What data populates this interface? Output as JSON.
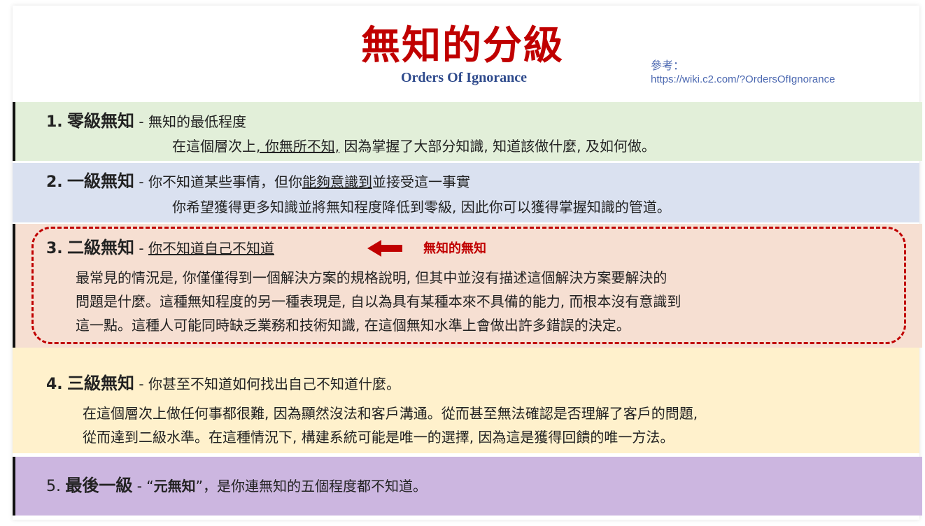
{
  "header": {
    "title": "無知的分級",
    "subtitle": "Orders Of Ignorance",
    "ref_label": "參考：",
    "ref_url": "https://wiki.c2.com/?OrdersOfIgnorance"
  },
  "levels": [
    {
      "number": "1.",
      "name": "零級無知",
      "sep": " - ",
      "headline": "無知的最低程度",
      "detail_pre": "在這個層次上",
      "detail_u": ", 你無所不知,",
      "detail_post": " 因為掌握了大部分知識, 知道該做什麼, 及如何做。"
    },
    {
      "number": "2.",
      "name": "一級無知",
      "sep": " - ",
      "headline_pre": "你不知道某些事情，但你",
      "headline_u": "能夠意識到",
      "headline_post": "並接受這一事實",
      "detail": "你希望獲得更多知識並將無知程度降低到零級, 因此你可以獲得掌握知識的管道。"
    },
    {
      "number": "3.",
      "name": "二級無知",
      "sep": " - ",
      "headline_u": "你不知道自己不知道",
      "callout": "無知的無知",
      "detail_lines": [
        "最常見的情況是, 你僅僅得到一個解決方案的規格說明, 但其中並沒有描述這個解決方案要解決的",
        "問題是什麼。這種無知程度的另一種表現是, 自以為具有某種本來不具備的能力, 而根本沒有意識到",
        "這一點。這種人可能同時缺乏業務和技術知識, 在這個無知水準上會做出許多錯誤的決定。"
      ]
    },
    {
      "number": "4.",
      "name": "三級無知",
      "sep": " - ",
      "headline": "你甚至不知道如何找出自己不知道什麼。",
      "detail_lines": [
        "在這個層次上做任何事都很難, 因為顯然沒法和客戶溝通。從而甚至無法確認是否理解了客戶的問題,",
        "從而達到二級水準。在這種情況下, 構建系統可能是唯一的選擇, 因為這是獲得回饋的唯一方法。"
      ]
    },
    {
      "number": "5.",
      "name": "最後一級",
      "sep": " - ",
      "quote_open": "“",
      "quote_term": "元無知",
      "quote_close": "”，",
      "headline": "是你連無知的五個程度都不知道。"
    }
  ],
  "colors": {
    "title": "#c00000",
    "subtitle": "#2e4a8c",
    "band1": "#e2efd9",
    "band2": "#dae1f0",
    "band3": "#f6dfd2",
    "band4": "#fff1cc",
    "band5": "#ccb6e0",
    "highlight": "#c00000"
  }
}
